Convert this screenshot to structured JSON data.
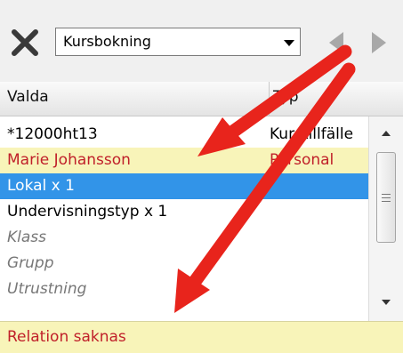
{
  "toolbar": {
    "combo_value": "Kursbokning",
    "close_icon": "close-x-icon",
    "nav_left_icon": "arrow-left-icon",
    "nav_right_icon": "arrow-right-icon"
  },
  "columns": {
    "col1": "Valda",
    "col2": "Typ"
  },
  "rows": [
    {
      "c1": "*12000ht13",
      "c2": "Kurstillfälle"
    },
    {
      "c1": "Marie Johansson",
      "c2": "Personal"
    },
    {
      "c1": "Lokal x 1",
      "c2": ""
    },
    {
      "c1": "Undervisningstyp x 1",
      "c2": ""
    },
    {
      "c1": "Klass",
      "c2": ""
    },
    {
      "c1": "Grupp",
      "c2": ""
    },
    {
      "c1": "Utrustning",
      "c2": ""
    }
  ],
  "status": {
    "text": "Relation saknas"
  },
  "colors": {
    "highlight_yellow": "#f8f4b9",
    "selection_blue": "#3294e8",
    "warning_red": "#c0202a",
    "annotation_arrow": "#e8241c"
  }
}
